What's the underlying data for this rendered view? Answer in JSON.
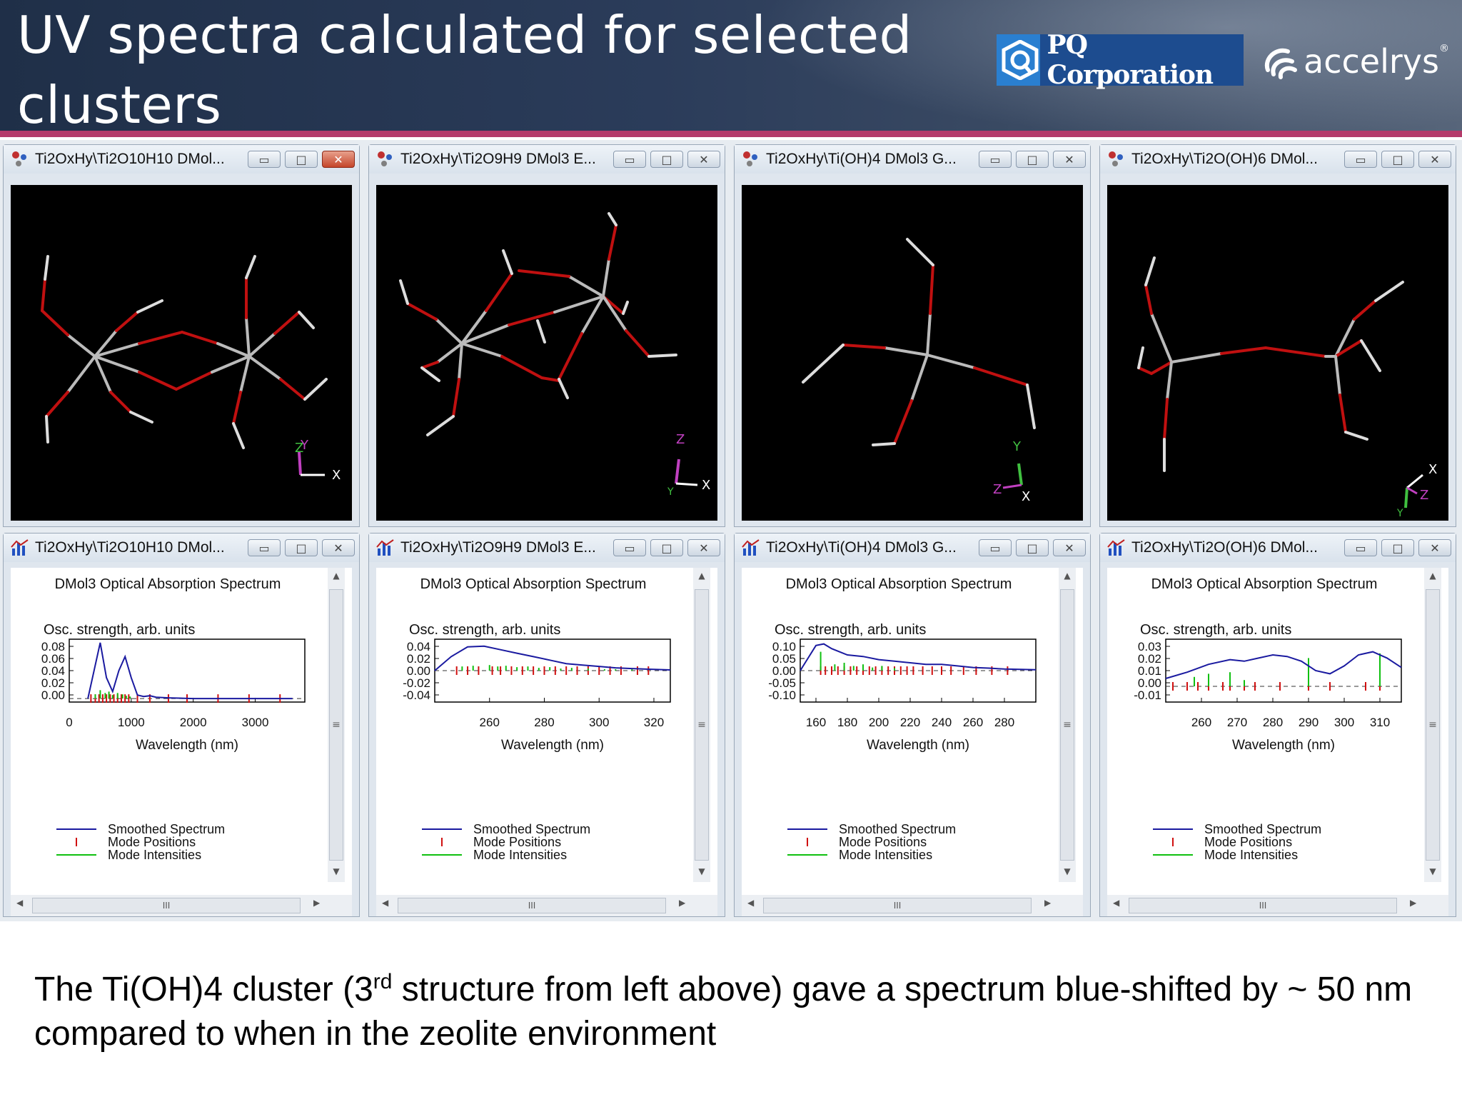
{
  "slide": {
    "title": "UV spectra calculated for selected clusters",
    "caption_pre": "The Ti(OH)4 cluster (3",
    "caption_sup": "rd",
    "caption_post": " structure from left above) gave a spectrum blue-shifted by ~ 50 nm compared to when in the zeolite environment"
  },
  "logos": {
    "pq": "PQ Corporation",
    "accelrys": "accelrys",
    "accelrys_mark": "®"
  },
  "colors": {
    "header_bg": "#22324c",
    "accent_line": "#b43a6a",
    "spectrum_line": "#1a1aa0",
    "mode_positions": "#d01010",
    "mode_intensities": "#10c010"
  },
  "structure_windows": [
    {
      "title": "Ti2OxHy\\Ti2O10H10 DMol...",
      "axes": [
        "Z",
        "Y",
        "X"
      ]
    },
    {
      "title": "Ti2OxHy\\Ti2O9H9 DMol3 E...",
      "axes": [
        "Z",
        "Y",
        "X"
      ]
    },
    {
      "title": "Ti2OxHy\\Ti(OH)4 DMol3 G...",
      "axes": [
        "Y",
        "Z",
        "X"
      ]
    },
    {
      "title": "Ti2OxHy\\Ti2O(OH)6 DMol...",
      "axes": [
        "X",
        "Z",
        "Y"
      ]
    }
  ],
  "spectrum_windows": [
    {
      "title": "Ti2OxHy\\Ti2O10H10 DMol..."
    },
    {
      "title": "Ti2OxHy\\Ti2O9H9 DMol3 E..."
    },
    {
      "title": "Ti2OxHy\\Ti(OH)4 DMol3 G..."
    },
    {
      "title": "Ti2OxHy\\Ti2O(OH)6 DMol..."
    }
  ],
  "window_buttons": {
    "minimize": "▭",
    "maximize": "□",
    "close": "✕"
  },
  "scroll": {
    "up": "▲",
    "down": "▼",
    "left": "◀",
    "right": "▶",
    "grip": "III",
    "vgrip": "≡"
  },
  "chart_data": [
    {
      "type": "line",
      "title": "DMol3 Optical Absorption Spectrum",
      "ylabel": "Osc. strength, arb. units",
      "xlabel": "Wavelength (nm)",
      "xticks": [
        0,
        1000,
        2000,
        3000
      ],
      "yticks": [
        "0.08",
        "0.06",
        "0.04",
        "0.02",
        "0.00"
      ],
      "xlim": [
        0,
        3800
      ],
      "ylim": [
        -0.005,
        0.085
      ],
      "legend": [
        "Smoothed Spectrum",
        "Mode Positions",
        "Mode Intensities"
      ],
      "series": [
        {
          "name": "Smoothed Spectrum",
          "x": [
            300,
            500,
            600,
            700,
            800,
            900,
            1000,
            1100,
            1200,
            1300,
            1400,
            1600,
            2000,
            2500,
            3000,
            3600
          ],
          "y": [
            0.0,
            0.08,
            0.03,
            0.01,
            0.04,
            0.06,
            0.03,
            0.005,
            0.003,
            0.004,
            0.002,
            0.001,
            0.0,
            0.0,
            0.0,
            0.0
          ]
        },
        {
          "name": "Mode Intensities",
          "x": [
            420,
            500,
            580,
            640,
            700,
            780,
            860,
            920,
            980
          ],
          "y": [
            0.006,
            0.012,
            0.008,
            0.01,
            0.005,
            0.008,
            0.006,
            0.004,
            0.003
          ]
        },
        {
          "name": "Mode Positions",
          "x": [
            350,
            420,
            480,
            540,
            600,
            660,
            720,
            780,
            840,
            900,
            960,
            1100,
            1300,
            1600,
            1900,
            2400,
            2900,
            3400
          ]
        }
      ]
    },
    {
      "type": "line",
      "title": "DMol3 Optical Absorption Spectrum",
      "ylabel": "Osc. strength, arb. units",
      "xlabel": "Wavelength (nm)",
      "xticks": [
        260,
        280,
        300,
        320
      ],
      "yticks": [
        "0.04",
        "0.02",
        "0.00",
        "-0.02",
        "-0.04"
      ],
      "xlim": [
        240,
        326
      ],
      "ylim": [
        -0.045,
        0.045
      ],
      "legend": [
        "Smoothed Spectrum",
        "Mode Positions",
        "Mode Intensities"
      ],
      "series": [
        {
          "name": "Smoothed Spectrum",
          "x": [
            240,
            246,
            252,
            258,
            264,
            270,
            276,
            282,
            288,
            294,
            300,
            306,
            312,
            318,
            326
          ],
          "y": [
            0.0,
            0.02,
            0.034,
            0.035,
            0.03,
            0.025,
            0.02,
            0.015,
            0.01,
            0.008,
            0.006,
            0.004,
            0.003,
            0.002,
            0.001
          ]
        },
        {
          "name": "Mode Intensities",
          "x": [
            250,
            254,
            260,
            263,
            266,
            270,
            274,
            278,
            282,
            286,
            290,
            296,
            302,
            306,
            312
          ],
          "y": [
            0.006,
            0.007,
            0.008,
            0.006,
            0.007,
            0.005,
            0.006,
            0.004,
            0.005,
            0.003,
            0.004,
            0.003,
            0.002,
            0.002,
            0.002
          ]
        },
        {
          "name": "Mode Positions",
          "x": [
            248,
            252,
            256,
            261,
            264,
            268,
            272,
            276,
            280,
            284,
            288,
            292,
            296,
            300,
            304,
            308,
            314,
            318
          ]
        }
      ]
    },
    {
      "type": "line",
      "title": "DMol3 Optical Absorption Spectrum",
      "ylabel": "Osc. strength, arb. units",
      "xlabel": "Wavelength (nm)",
      "xticks": [
        160,
        180,
        200,
        220,
        240,
        260,
        280
      ],
      "yticks": [
        "0.10",
        "0.05",
        "0.00",
        "-0.05",
        "-0.10"
      ],
      "xlim": [
        150,
        300
      ],
      "ylim": [
        -0.1,
        0.1
      ],
      "legend": [
        "Smoothed Spectrum",
        "Mode Positions",
        "Mode Intensities"
      ],
      "series": [
        {
          "name": "Smoothed Spectrum",
          "x": [
            150,
            155,
            160,
            165,
            170,
            180,
            190,
            200,
            210,
            220,
            230,
            240,
            250,
            260,
            270,
            280,
            290,
            300
          ],
          "y": [
            0.0,
            0.04,
            0.08,
            0.085,
            0.07,
            0.05,
            0.045,
            0.035,
            0.03,
            0.025,
            0.02,
            0.02,
            0.015,
            0.01,
            0.008,
            0.005,
            0.004,
            0.003
          ]
        },
        {
          "name": "Mode Intensities",
          "x": [
            163,
            172,
            178,
            184,
            190,
            196,
            202,
            210
          ],
          "y": [
            0.06,
            0.02,
            0.025,
            0.015,
            0.02,
            0.01,
            0.015,
            0.008
          ]
        },
        {
          "name": "Mode Positions",
          "x": [
            163,
            166,
            170,
            174,
            178,
            182,
            186,
            190,
            194,
            198,
            202,
            206,
            210,
            214,
            218,
            222,
            228,
            234,
            240,
            246,
            254,
            262,
            272,
            282
          ]
        }
      ]
    },
    {
      "type": "line",
      "title": "DMol3 Optical Absorption Spectrum",
      "ylabel": "Osc. strength, arb. units",
      "xlabel": "Wavelength (nm)",
      "xticks": [
        260,
        270,
        280,
        290,
        300,
        310
      ],
      "yticks": [
        "0.03",
        "0.02",
        "0.01",
        "0.00",
        "-0.01"
      ],
      "xlim": [
        250,
        316
      ],
      "ylim": [
        -0.01,
        0.03
      ],
      "legend": [
        "Smoothed Spectrum",
        "Mode Positions",
        "Mode Intensities"
      ],
      "series": [
        {
          "name": "Smoothed Spectrum",
          "x": [
            250,
            256,
            262,
            268,
            272,
            276,
            280,
            284,
            288,
            292,
            296,
            300,
            304,
            308,
            312,
            316
          ],
          "y": [
            0.005,
            0.009,
            0.014,
            0.017,
            0.016,
            0.018,
            0.02,
            0.019,
            0.016,
            0.01,
            0.008,
            0.013,
            0.02,
            0.022,
            0.018,
            0.012
          ]
        },
        {
          "name": "Mode Intensities",
          "x": [
            258,
            262,
            268,
            272,
            290,
            310
          ],
          "y": [
            0.006,
            0.008,
            0.009,
            0.004,
            0.018,
            0.021
          ]
        },
        {
          "name": "Mode Positions",
          "x": [
            252,
            256,
            259,
            262,
            266,
            268,
            272,
            275,
            282,
            290,
            296,
            306,
            310
          ]
        }
      ]
    }
  ]
}
